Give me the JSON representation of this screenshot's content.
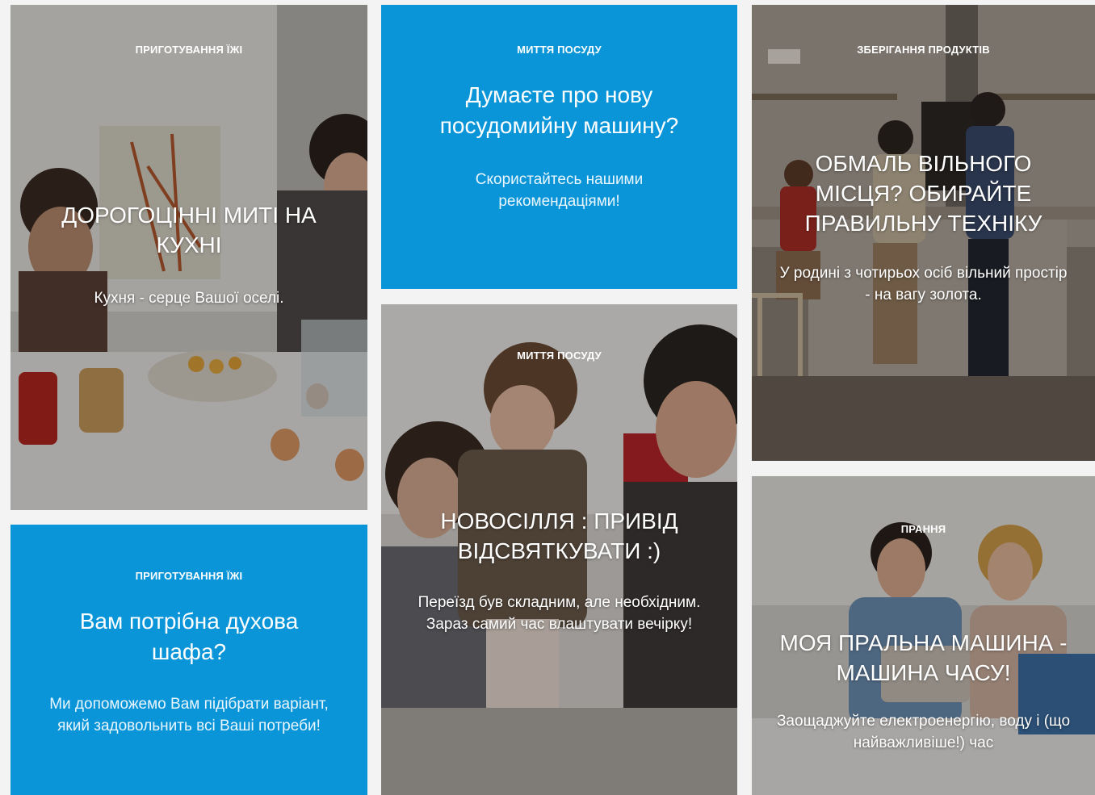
{
  "tiles": [
    {
      "category": "ПРИГОТУВАННЯ ЇЖІ",
      "title": "ДОРОГОЦІННІ МИТІ НА КУХНІ",
      "description": "Кухня - серце Вашої оселі."
    },
    {
      "category": "МИТТЯ ПОСУДУ",
      "title": "Думаєте про нову посудомийну машину?",
      "description": "Скористайтесь нашими рекомендаціями!"
    },
    {
      "category": "ЗБЕРІГАННЯ ПРОДУКТІВ",
      "title": "ОБМАЛЬ ВІЛЬНОГО МІСЦЯ? ОБИРАЙТЕ ПРАВИЛЬНУ ТЕХНІКУ",
      "description": "У родині з чотирьох осіб вільний простір - на вагу золота."
    },
    {
      "category": "МИТТЯ ПОСУДУ",
      "title": "НОВОСІЛЛЯ : ПРИВІД ВІДСВЯТКУВАТИ :)",
      "description": "Переїзд був складним, але необхідним. Зараз самий час влаштувати вечірку!"
    },
    {
      "category": "ПРИГОТУВАННЯ ЇЖІ",
      "title": "Вам потрібна духова шафа?",
      "description": "Ми допоможемо Вам підібрати варіант, який задовольнить всі Ваші потреби!"
    },
    {
      "category": "ПРАННЯ",
      "title": "МОЯ ПРАЛЬНА МАШИНА - МАШИНА ЧАСУ!",
      "description": "Заощаджуйте електроенергію, воду і (що найважливіше!) час"
    }
  ],
  "colors": {
    "tile_blue": "#0a95d8",
    "background": "#f3f3f3"
  }
}
